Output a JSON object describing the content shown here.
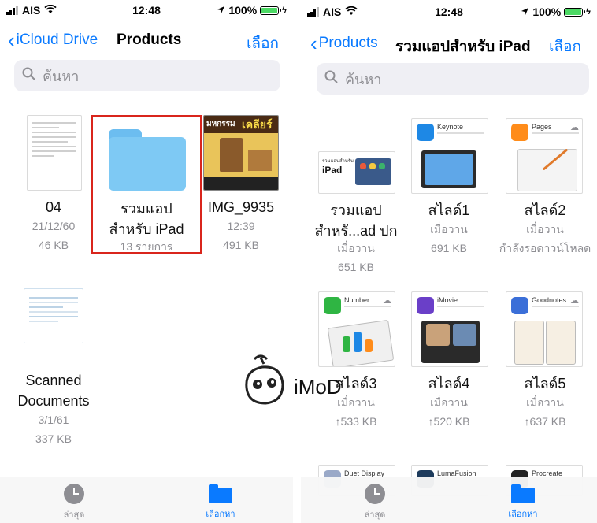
{
  "status": {
    "carrier": "AIS",
    "time": "12:48",
    "battery": "100%"
  },
  "left": {
    "back_label": "iCloud Drive",
    "title": "Products",
    "action": "เลือก",
    "search_placeholder": "ค้นหา",
    "items": [
      {
        "name": "04",
        "date": "21/12/60",
        "size": "46 KB"
      },
      {
        "name_line1": "รวมแอป",
        "name_line2": "สำหรับ iPad",
        "count": "13 รายการ"
      },
      {
        "name": "IMG_9935",
        "time": "12:39",
        "size": "491 KB",
        "banner_a": "มหกรรม",
        "banner_b": "เคลียร์"
      },
      {
        "name_line1": "Scanned",
        "name_line2": "Documents",
        "date": "3/1/61",
        "size": "337 KB"
      }
    ],
    "tabs": [
      {
        "label": "ล่าสุด",
        "icon": "clock-icon"
      },
      {
        "label": "เลือกหา",
        "icon": "folder-icon"
      }
    ]
  },
  "right": {
    "back_label": "Products",
    "title": "รวมแอปสำหรับ iPad",
    "action": "เลือก",
    "search_placeholder": "ค้นหา",
    "items": [
      {
        "name_line1": "รวมแอป",
        "name_line2": "สำหรั...ad ปก",
        "date": "เมื่อวาน",
        "size": "651 KB",
        "thumb_line1": "รวมแอปสำหรับ",
        "thumb_line2": "iPad"
      },
      {
        "name": "สไลด์1",
        "date": "เมื่อวาน",
        "size": "691 KB",
        "app": "Keynote",
        "color": "#1e88e5"
      },
      {
        "name": "สไลด์2",
        "date": "เมื่อวาน",
        "size": "กำลังรอดาวน์โหลด",
        "app": "Pages",
        "color": "#ff8c1a"
      },
      {
        "name": "สไลด์3",
        "date": "เมื่อวาน",
        "size": "↑533 KB",
        "app": "Number",
        "color": "#2fb543"
      },
      {
        "name": "สไลด์4",
        "date": "เมื่อวาน",
        "size": "↑520 KB",
        "app": "iMovie",
        "color": "#6a3fc8"
      },
      {
        "name": "สไลด์5",
        "date": "เมื่อวาน",
        "size": "↑637 KB",
        "app": "Goodnotes",
        "color": "#3b6fd8"
      },
      {
        "app": "Duet Display",
        "color": "#9aa9c8"
      },
      {
        "app": "LumaFusion",
        "color": "#1d3b5c"
      },
      {
        "app": "Procreate",
        "color": "#222222"
      }
    ],
    "tabs": [
      {
        "label": "ล่าสุด",
        "icon": "clock-icon"
      },
      {
        "label": "เลือกหา",
        "icon": "folder-icon"
      }
    ]
  },
  "watermark": "iMoD",
  "colors": {
    "accent": "#0a7aff",
    "selection": "#d9251c",
    "folder": "#7ec9f4"
  }
}
